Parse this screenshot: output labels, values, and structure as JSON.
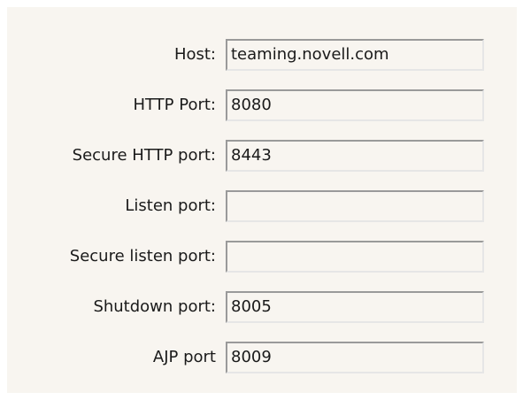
{
  "form": {
    "fields": [
      {
        "label": "Host:",
        "value": "teaming.novell.com"
      },
      {
        "label": "HTTP Port:",
        "value": "8080"
      },
      {
        "label": "Secure HTTP port:",
        "value": "8443"
      },
      {
        "label": "Listen port:",
        "value": ""
      },
      {
        "label": "Secure listen port:",
        "value": ""
      },
      {
        "label": "Shutdown port:",
        "value": "8005"
      },
      {
        "label": "AJP port",
        "value": "8009"
      }
    ]
  }
}
